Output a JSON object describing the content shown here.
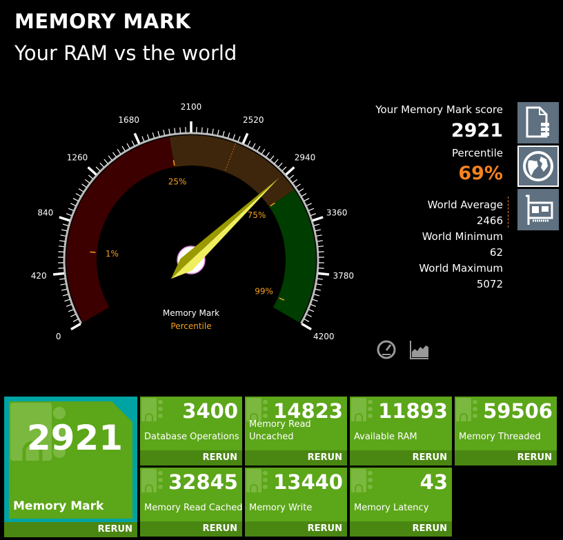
{
  "header": {
    "title": "MEMORY MARK",
    "subtitle": "Your RAM vs the world"
  },
  "gauge": {
    "min": 0,
    "max": 4200,
    "value": 2921,
    "tick_labels": [
      "0",
      "420",
      "840",
      "1260",
      "1680",
      "2100",
      "2520",
      "2940",
      "3360",
      "3780",
      "4200"
    ],
    "percentile_markers": [
      {
        "label": "1%",
        "value": 604
      },
      {
        "label": "25%",
        "value": 1925
      },
      {
        "label": "75%",
        "value": 3075
      },
      {
        "label": "99%",
        "value": 4083
      }
    ],
    "world_average_marker": 2466,
    "bands": [
      {
        "from": 0,
        "to": 1925,
        "color": "#3d0000"
      },
      {
        "from": 1925,
        "to": 3075,
        "color": "#3e260c"
      },
      {
        "from": 3075,
        "to": 4200,
        "color": "#003d00"
      }
    ],
    "caption": "Memory Mark",
    "caption_sub": "Percentile"
  },
  "score": {
    "label": "Your Memory Mark score",
    "value": "2921",
    "percentile_label": "Percentile",
    "percentile": "69%",
    "world_average_label": "World Average",
    "world_average": "2466",
    "world_min_label": "World Minimum",
    "world_min": "62",
    "world_max_label": "World Maximum",
    "world_max": "5072"
  },
  "side_icons": [
    "document-database-icon",
    "globe-icon",
    "memory-card-icon"
  ],
  "bottom_icons": [
    "gauge-icon",
    "chart-icon"
  ],
  "colors": {
    "tile": "#5ca619",
    "rerun_bar": "#4a8612",
    "selected_border": "#00a3a3",
    "orange": "#f58220",
    "needle": "#e8e860"
  },
  "tiles": {
    "main": {
      "value": "2921",
      "label": "Memory Mark",
      "rerun": "RERUN"
    },
    "items": [
      {
        "value": "3400",
        "label": "Database Operations",
        "rerun": "RERUN"
      },
      {
        "value": "14823",
        "label": "Memory Read\nUncached",
        "rerun": "RERUN"
      },
      {
        "value": "11893",
        "label": "Available RAM",
        "rerun": "RERUN"
      },
      {
        "value": "59506",
        "label": "Memory Threaded",
        "rerun": "RERUN"
      },
      {
        "value": "32845",
        "label": "Memory Read Cached",
        "rerun": "RERUN"
      },
      {
        "value": "13440",
        "label": "Memory Write",
        "rerun": "RERUN"
      },
      {
        "value": "43",
        "label": "Memory Latency",
        "rerun": "RERUN"
      }
    ]
  }
}
